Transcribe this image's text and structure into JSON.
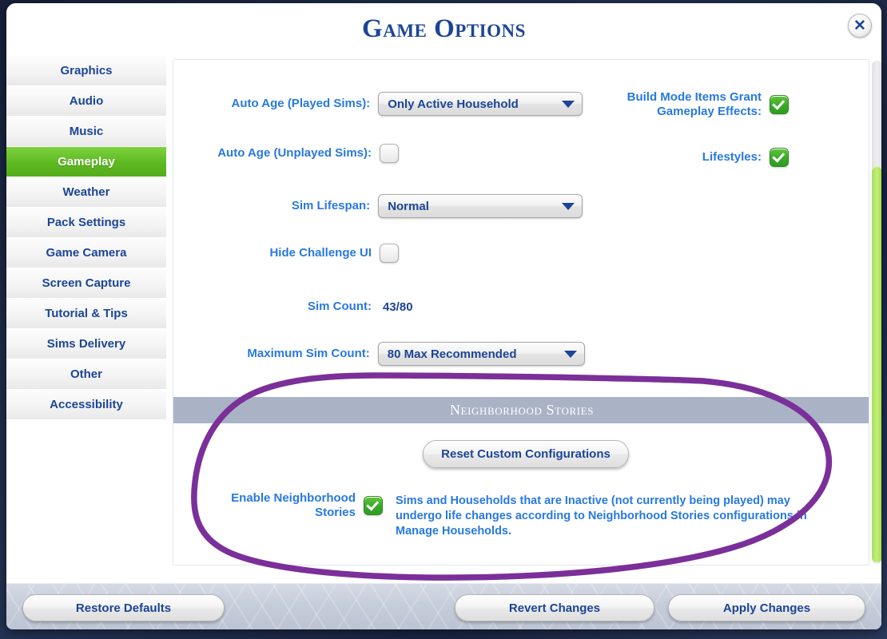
{
  "window": {
    "title": "Game Options",
    "close_icon": "close-x-icon"
  },
  "sidebar": {
    "items": [
      {
        "label": "Graphics",
        "selected": false
      },
      {
        "label": "Audio",
        "selected": false
      },
      {
        "label": "Music",
        "selected": false
      },
      {
        "label": "Gameplay",
        "selected": true
      },
      {
        "label": "Weather",
        "selected": false
      },
      {
        "label": "Pack Settings",
        "selected": false
      },
      {
        "label": "Game Camera",
        "selected": false
      },
      {
        "label": "Screen Capture",
        "selected": false
      },
      {
        "label": "Tutorial & Tips",
        "selected": false
      },
      {
        "label": "Sims Delivery",
        "selected": false
      },
      {
        "label": "Other",
        "selected": false
      },
      {
        "label": "Accessibility",
        "selected": false
      }
    ]
  },
  "settings": {
    "auto_age_played": {
      "label": "Auto Age (Played Sims):",
      "value": "Only Active Household",
      "control": "dropdown"
    },
    "auto_age_unplayed": {
      "label": "Auto Age (Unplayed Sims):",
      "checked": false,
      "control": "checkbox"
    },
    "sim_lifespan": {
      "label": "Sim Lifespan:",
      "value": "Normal",
      "control": "dropdown"
    },
    "hide_challenge_ui": {
      "label": "Hide Challenge UI",
      "checked": false,
      "control": "checkbox"
    },
    "sim_count": {
      "label": "Sim Count:",
      "value": "43/80",
      "control": "readonly"
    },
    "maximum_sim_count": {
      "label": "Maximum Sim Count:",
      "value": "80 Max Recommended",
      "control": "dropdown"
    },
    "build_mode_items": {
      "label_line1": "Build Mode Items Grant",
      "label_line2": "Gameplay Effects:",
      "checked": true,
      "control": "checkbox"
    },
    "lifestyles": {
      "label": "Lifestyles:",
      "checked": true,
      "control": "checkbox"
    }
  },
  "neighborhood_stories": {
    "section_title": "Neighborhood Stories",
    "reset_button": "Reset Custom Configurations",
    "enable_label_line1": "Enable Neighborhood",
    "enable_label_line2": "Stories",
    "enable_checked": true,
    "description": "Sims and Households that are Inactive (not currently being played) may undergo life changes according to Neighborhood Stories configurations in Manage Households."
  },
  "footer": {
    "restore_defaults": "Restore Defaults",
    "revert_changes": "Revert Changes",
    "apply_changes": "Apply Changes"
  },
  "scrollbar": {
    "thumb_name": "vertical-scroll-thumb"
  },
  "colors": {
    "accent_blue": "#1c4596",
    "label_blue": "#2879e0",
    "selected_green": "#5cb821",
    "checkbox_green": "#39a92a",
    "section_band": "#aab3c6",
    "annotation_purple": "#7b2f99",
    "scroll_thumb_green": "#b5e75f"
  }
}
